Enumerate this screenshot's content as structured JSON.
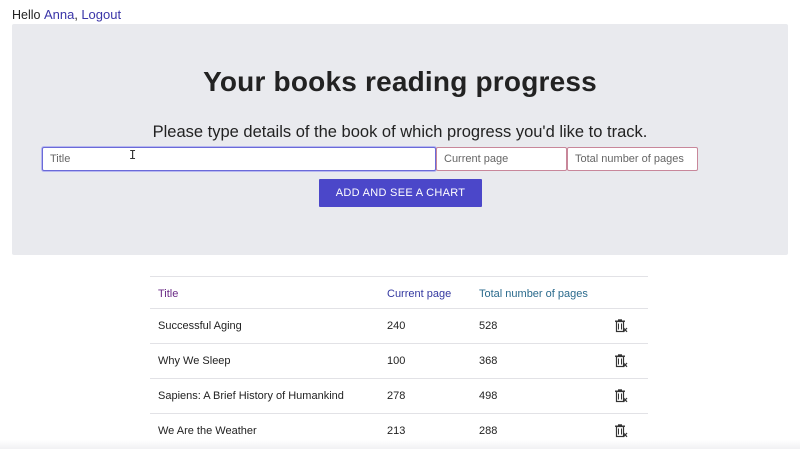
{
  "header": {
    "greeting": "Hello",
    "user_name": "Anna",
    "separator": ",",
    "logout_label": "Logout"
  },
  "main": {
    "title": "Your books reading progress",
    "subtitle": "Please type details of the book of which progress you'd like to track.",
    "form": {
      "title_placeholder": "Title",
      "current_page_placeholder": "Current page",
      "total_pages_placeholder": "Total number of pages",
      "submit_label": "ADD AND SEE A CHART"
    }
  },
  "table": {
    "columns": {
      "title": "Title",
      "current_page": "Current page",
      "total_pages": "Total number of pages"
    },
    "rows": [
      {
        "title": "Successful Aging",
        "current_page": "240",
        "total_pages": "528"
      },
      {
        "title": "Why We Sleep",
        "current_page": "100",
        "total_pages": "368"
      },
      {
        "title": "Sapiens: A Brief History of Humankind",
        "current_page": "278",
        "total_pages": "498"
      },
      {
        "title": "We Are the Weather",
        "current_page": "213",
        "total_pages": "288"
      }
    ]
  },
  "icons": {
    "delete": "trash-delete-icon",
    "cursor": "text-cursor-icon"
  },
  "colors": {
    "accent": "#4b47c9",
    "panel_bg": "#e9eaee",
    "link": "#3a35a8",
    "col_title": "#6a2a86",
    "col_current": "#3338a0",
    "col_total": "#2a6a8c"
  }
}
